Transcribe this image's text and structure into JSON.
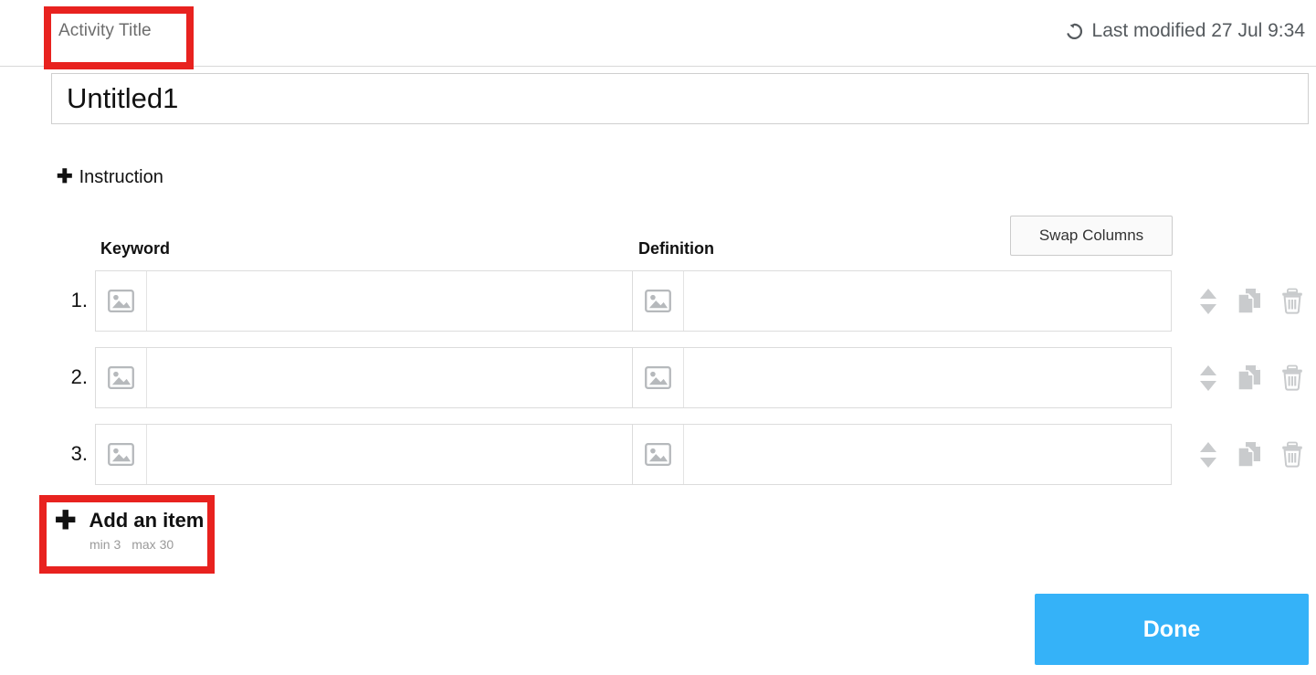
{
  "header": {
    "activity_title_label": "Activity Title",
    "last_modified_text": "Last modified 27 Jul 9:34",
    "history_icon": "history-icon"
  },
  "title_field": {
    "value": "Untitled1",
    "placeholder": "Activity Title"
  },
  "instruction": {
    "plus": "✚",
    "label": "Instruction"
  },
  "table": {
    "columns": {
      "keyword": "Keyword",
      "definition": "Definition"
    },
    "swap_columns_label": "Swap Columns",
    "rows": [
      {
        "number": "1.",
        "keyword_value": "",
        "keyword_placeholder": "",
        "definition_value": "",
        "definition_placeholder": "",
        "keyword_image_icon": "image-placeholder-icon",
        "definition_image_icon": "image-placeholder-icon",
        "actions": {
          "reorder": "reorder-updown-icon",
          "duplicate": "duplicate-icon",
          "delete": "trash-icon"
        }
      },
      {
        "number": "2.",
        "keyword_value": "",
        "keyword_placeholder": "",
        "definition_value": "",
        "definition_placeholder": "",
        "keyword_image_icon": "image-placeholder-icon",
        "definition_image_icon": "image-placeholder-icon",
        "actions": {
          "reorder": "reorder-updown-icon",
          "duplicate": "duplicate-icon",
          "delete": "trash-icon"
        }
      },
      {
        "number": "3.",
        "keyword_value": "",
        "keyword_placeholder": "",
        "definition_value": "",
        "definition_placeholder": "",
        "keyword_image_icon": "image-placeholder-icon",
        "definition_image_icon": "image-placeholder-icon",
        "actions": {
          "reorder": "reorder-updown-icon",
          "duplicate": "duplicate-icon",
          "delete": "trash-icon"
        }
      }
    ]
  },
  "add_item": {
    "plus": "✚",
    "label": "Add an item",
    "min_text": "min 3",
    "max_text": "max 30"
  },
  "footer": {
    "done_label": "Done"
  },
  "annotations": [
    {
      "name": "activity-title-highlight",
      "color": "#e8221f"
    },
    {
      "name": "add-an-item-highlight",
      "color": "#e8221f"
    }
  ],
  "colors": {
    "accent_blue": "#35b2f8",
    "annotation_red": "#e8221f",
    "border_gray": "#dcdcdc",
    "muted_text": "#9a9a9a"
  }
}
